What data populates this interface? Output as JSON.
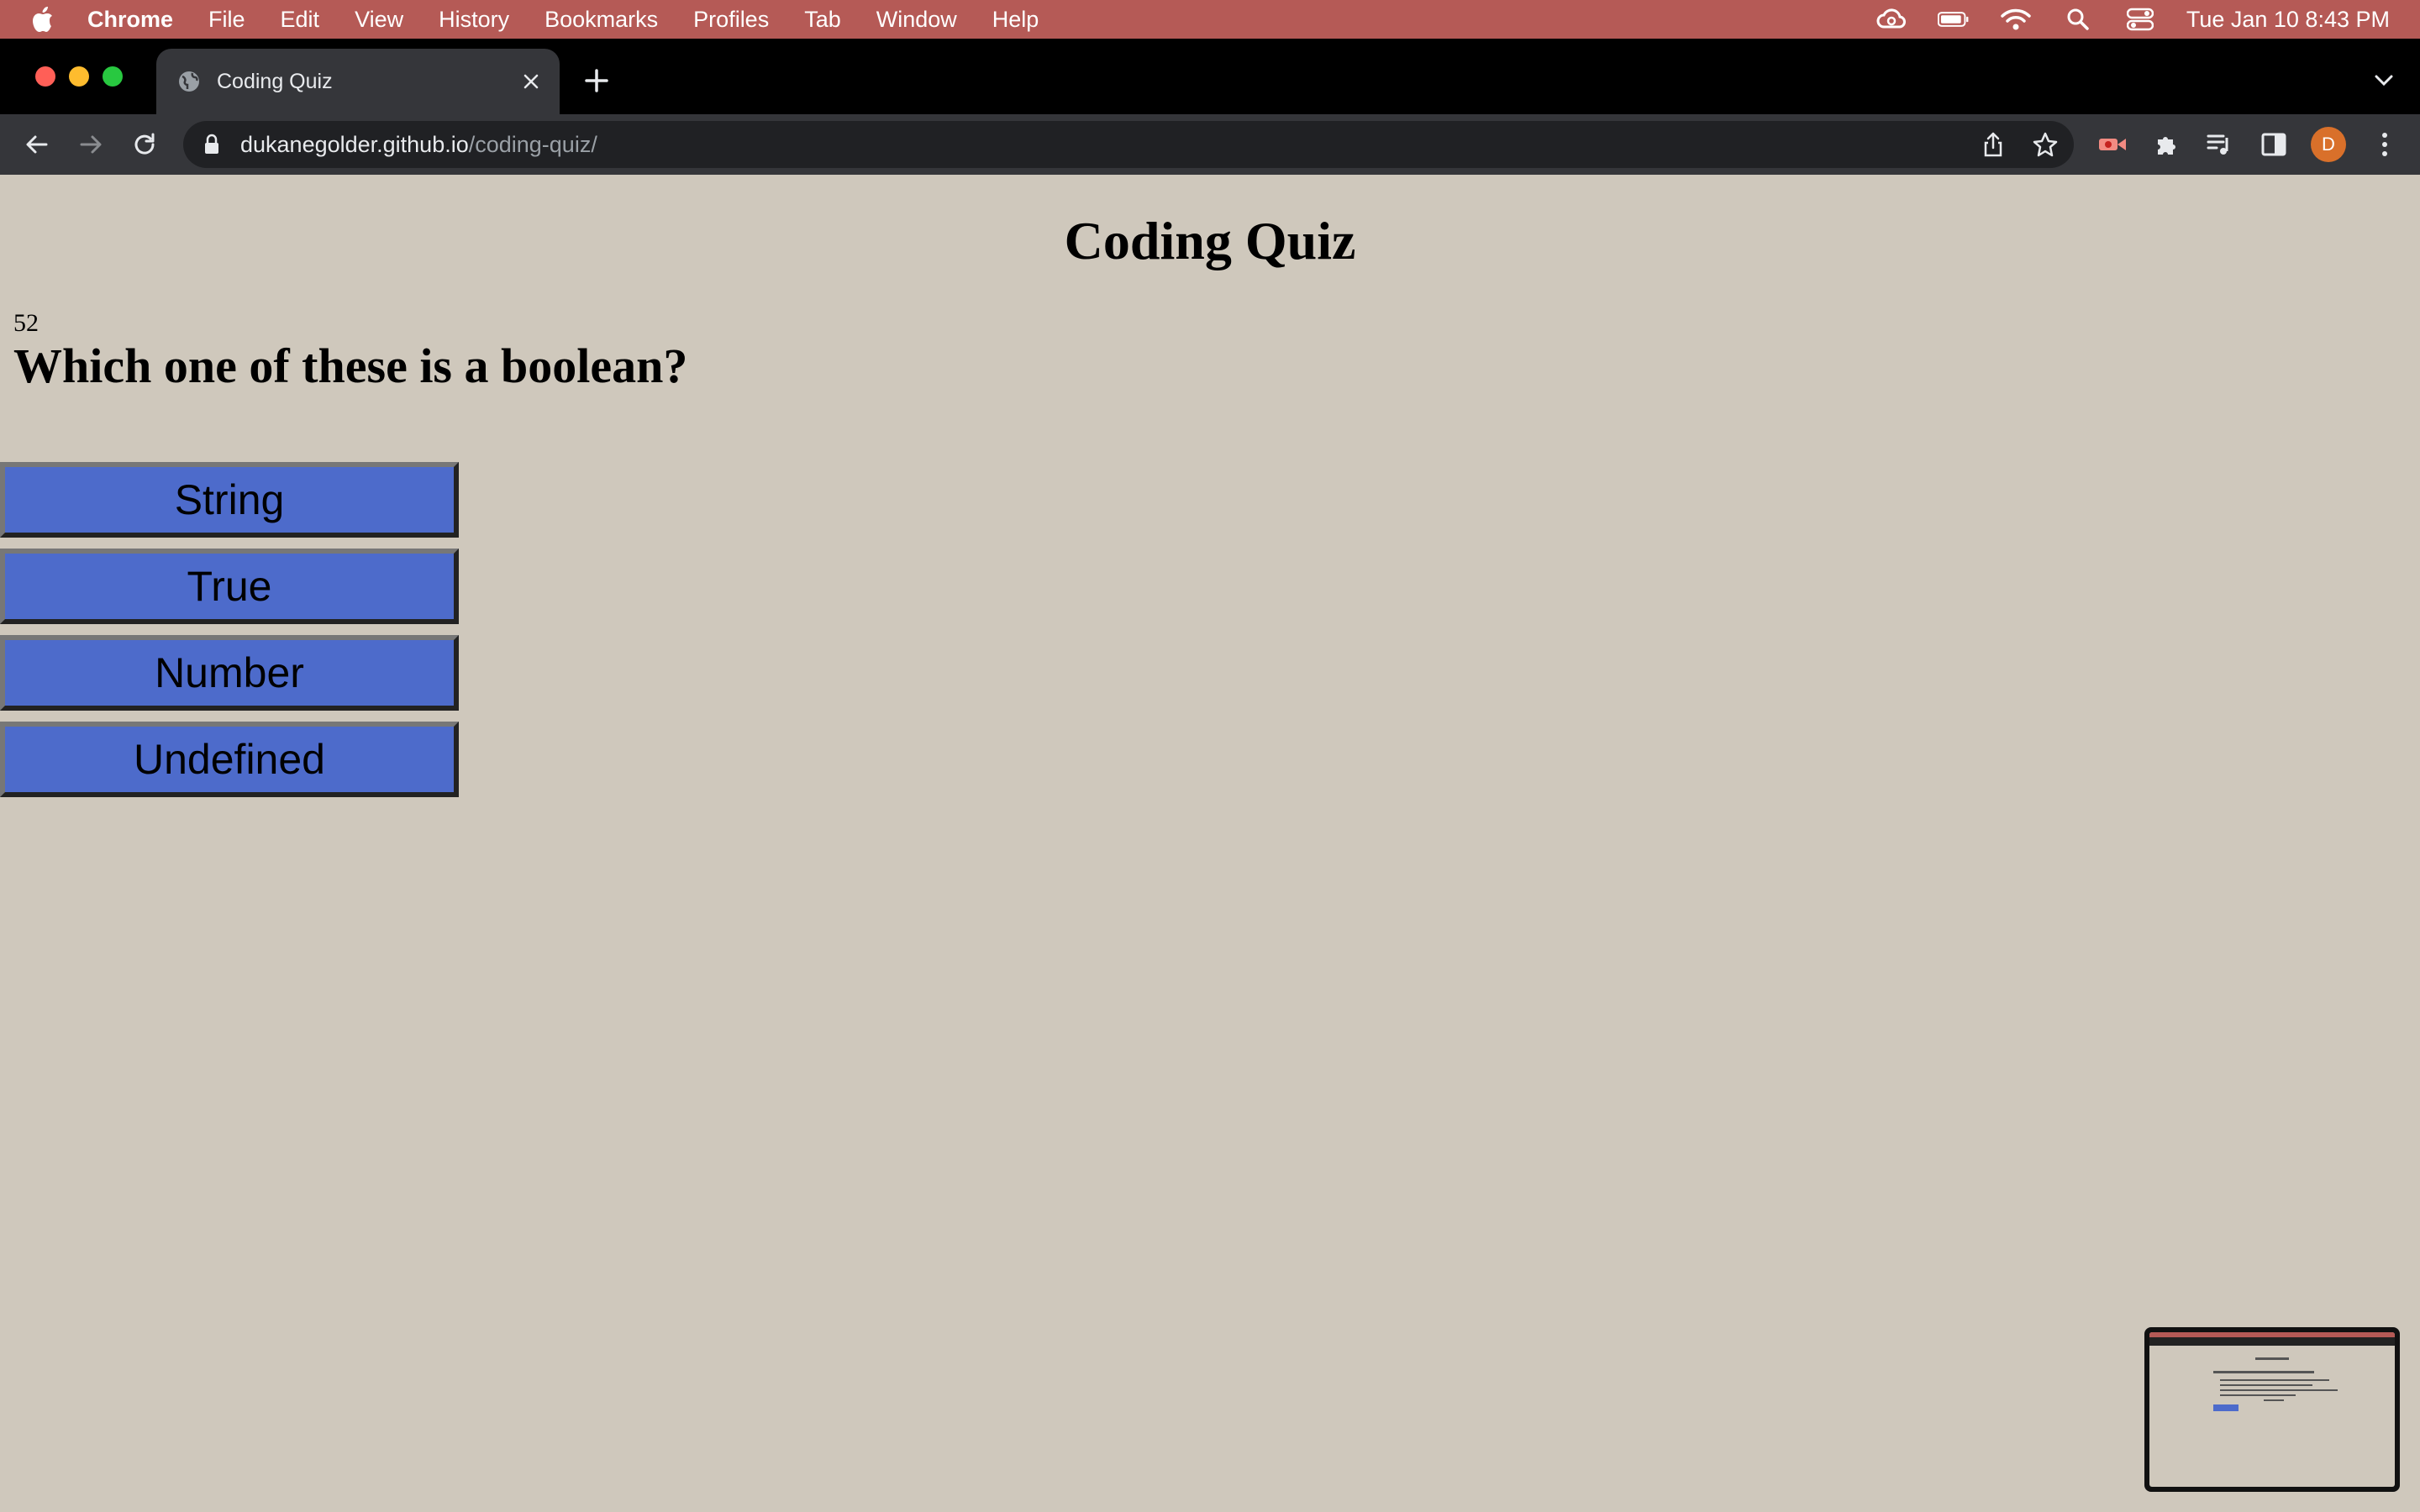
{
  "menubar": {
    "app_name": "Chrome",
    "items": [
      "File",
      "Edit",
      "View",
      "History",
      "Bookmarks",
      "Profiles",
      "Tab",
      "Window",
      "Help"
    ],
    "clock": "Tue Jan 10  8:43 PM",
    "status_icons": [
      "creative-cloud-icon",
      "battery-icon",
      "wifi-icon",
      "search-icon",
      "control-center-icon"
    ]
  },
  "browser": {
    "tab_title": "Coding Quiz",
    "url_host": "dukanegolder.github.io",
    "url_path": "/coding-quiz/",
    "profile_initial": "D"
  },
  "quiz": {
    "title": "Coding Quiz",
    "timer": "52",
    "question": "Which one of these is a boolean?",
    "answers": [
      "String",
      "True",
      "Number",
      "Undefined"
    ]
  },
  "colors": {
    "page_bg": "#cfc8bc",
    "answer_button": "#4d6bcb",
    "menubar": "#b55a56"
  }
}
